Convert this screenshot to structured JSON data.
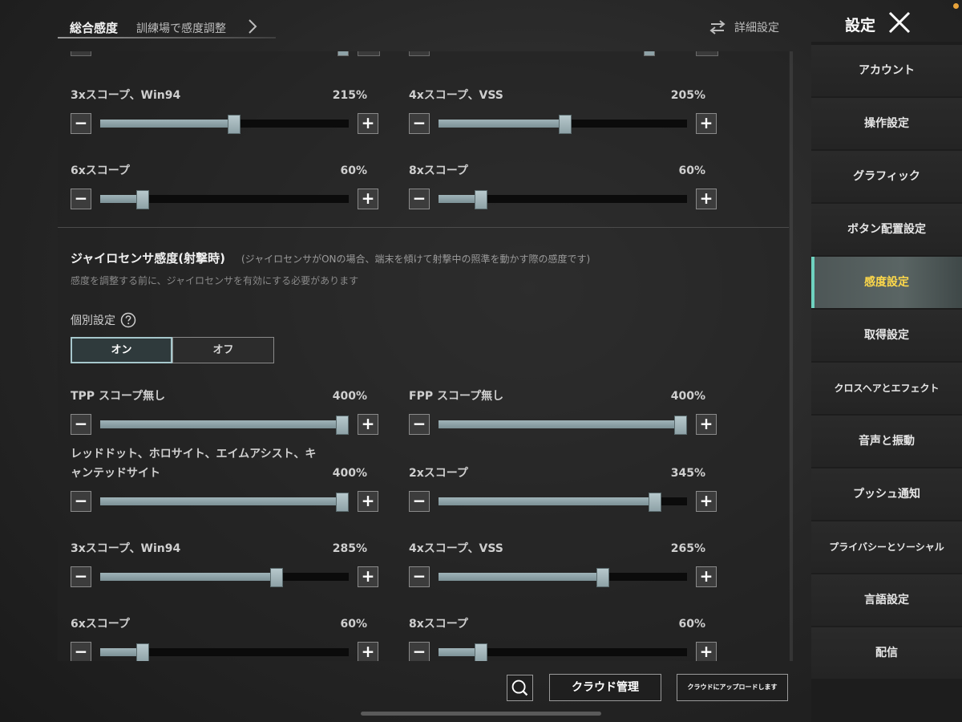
{
  "header": {
    "tab_main": "総合感度",
    "tab_training": "訓練場で感度調整",
    "detail_settings": "詳細設定",
    "title": "設定"
  },
  "upper_sliders": [
    {
      "label": "3xスコープ、Win94",
      "value": "215%",
      "fill": 0.54
    },
    {
      "label": "4xスコープ、VSS",
      "value": "205%",
      "fill": 0.51
    },
    {
      "label": "6xスコープ",
      "value": "60%",
      "fill": 0.17
    },
    {
      "label": "8xスコープ",
      "value": "60%",
      "fill": 0.17
    }
  ],
  "gyro": {
    "title": "ジャイロセンサ感度(射撃時)",
    "description": "(ジャイロセンサがONの場合、端末を傾けて射撃中の照準を動かす際の感度です)",
    "note": "感度を調整する前に、ジャイロセンサを有効にする必要があります",
    "individual_label": "個別設定",
    "toggle_on": "オン",
    "toggle_off": "オフ"
  },
  "gyro_sliders": [
    {
      "label": "TPP スコープ無し",
      "value": "400%",
      "fill": 1.0
    },
    {
      "label": "FPP スコープ無し",
      "value": "400%",
      "fill": 1.0
    },
    {
      "label": "レッドドット、ホロサイト、エイムアシスト、キャンテッドサイト",
      "value": "400%",
      "fill": 1.0
    },
    {
      "label": "2xスコープ",
      "value": "345%",
      "fill": 0.87
    },
    {
      "label": "3xスコープ、Win94",
      "value": "285%",
      "fill": 0.71
    },
    {
      "label": "4xスコープ、VSS",
      "value": "265%",
      "fill": 0.66
    },
    {
      "label": "6xスコープ",
      "value": "60%",
      "fill": 0.17
    },
    {
      "label": "8xスコープ",
      "value": "60%",
      "fill": 0.17
    }
  ],
  "buttons": {
    "minus": "−",
    "plus": "+",
    "cloud_manage": "クラウド管理",
    "cloud_upload": "クラウドにアップロードします"
  },
  "nav": {
    "items": [
      {
        "label": "アカウント"
      },
      {
        "label": "操作設定"
      },
      {
        "label": "グラフィック"
      },
      {
        "label": "ボタン配置設定"
      },
      {
        "label": "感度設定"
      },
      {
        "label": "取得設定"
      },
      {
        "label": "クロスヘアとエフェクト"
      },
      {
        "label": "音声と振動"
      },
      {
        "label": "プッシュ通知"
      },
      {
        "label": "プライバシーとソーシャル"
      },
      {
        "label": "言語設定"
      },
      {
        "label": "配信"
      }
    ],
    "active_index": 4
  },
  "colors": {
    "accent_active_text": "#ffd94a",
    "accent_active_bar": "#6fd3c0",
    "slider_fill": "#9fb3b8",
    "status_dot": "#e8a33a"
  }
}
